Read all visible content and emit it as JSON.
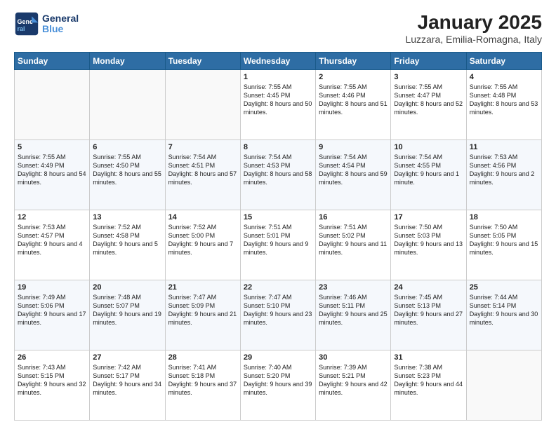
{
  "header": {
    "logo_line1": "General",
    "logo_line2": "Blue",
    "title": "January 2025",
    "subtitle": "Luzzara, Emilia-Romagna, Italy"
  },
  "weekdays": [
    "Sunday",
    "Monday",
    "Tuesday",
    "Wednesday",
    "Thursday",
    "Friday",
    "Saturday"
  ],
  "weeks": [
    [
      {
        "day": "",
        "info": ""
      },
      {
        "day": "",
        "info": ""
      },
      {
        "day": "",
        "info": ""
      },
      {
        "day": "1",
        "info": "Sunrise: 7:55 AM\nSunset: 4:45 PM\nDaylight: 8 hours\nand 50 minutes."
      },
      {
        "day": "2",
        "info": "Sunrise: 7:55 AM\nSunset: 4:46 PM\nDaylight: 8 hours\nand 51 minutes."
      },
      {
        "day": "3",
        "info": "Sunrise: 7:55 AM\nSunset: 4:47 PM\nDaylight: 8 hours\nand 52 minutes."
      },
      {
        "day": "4",
        "info": "Sunrise: 7:55 AM\nSunset: 4:48 PM\nDaylight: 8 hours\nand 53 minutes."
      }
    ],
    [
      {
        "day": "5",
        "info": "Sunrise: 7:55 AM\nSunset: 4:49 PM\nDaylight: 8 hours\nand 54 minutes."
      },
      {
        "day": "6",
        "info": "Sunrise: 7:55 AM\nSunset: 4:50 PM\nDaylight: 8 hours\nand 55 minutes."
      },
      {
        "day": "7",
        "info": "Sunrise: 7:54 AM\nSunset: 4:51 PM\nDaylight: 8 hours\nand 57 minutes."
      },
      {
        "day": "8",
        "info": "Sunrise: 7:54 AM\nSunset: 4:53 PM\nDaylight: 8 hours\nand 58 minutes."
      },
      {
        "day": "9",
        "info": "Sunrise: 7:54 AM\nSunset: 4:54 PM\nDaylight: 8 hours\nand 59 minutes."
      },
      {
        "day": "10",
        "info": "Sunrise: 7:54 AM\nSunset: 4:55 PM\nDaylight: 9 hours\nand 1 minute."
      },
      {
        "day": "11",
        "info": "Sunrise: 7:53 AM\nSunset: 4:56 PM\nDaylight: 9 hours\nand 2 minutes."
      }
    ],
    [
      {
        "day": "12",
        "info": "Sunrise: 7:53 AM\nSunset: 4:57 PM\nDaylight: 9 hours\nand 4 minutes."
      },
      {
        "day": "13",
        "info": "Sunrise: 7:52 AM\nSunset: 4:58 PM\nDaylight: 9 hours\nand 5 minutes."
      },
      {
        "day": "14",
        "info": "Sunrise: 7:52 AM\nSunset: 5:00 PM\nDaylight: 9 hours\nand 7 minutes."
      },
      {
        "day": "15",
        "info": "Sunrise: 7:51 AM\nSunset: 5:01 PM\nDaylight: 9 hours\nand 9 minutes."
      },
      {
        "day": "16",
        "info": "Sunrise: 7:51 AM\nSunset: 5:02 PM\nDaylight: 9 hours\nand 11 minutes."
      },
      {
        "day": "17",
        "info": "Sunrise: 7:50 AM\nSunset: 5:03 PM\nDaylight: 9 hours\nand 13 minutes."
      },
      {
        "day": "18",
        "info": "Sunrise: 7:50 AM\nSunset: 5:05 PM\nDaylight: 9 hours\nand 15 minutes."
      }
    ],
    [
      {
        "day": "19",
        "info": "Sunrise: 7:49 AM\nSunset: 5:06 PM\nDaylight: 9 hours\nand 17 minutes."
      },
      {
        "day": "20",
        "info": "Sunrise: 7:48 AM\nSunset: 5:07 PM\nDaylight: 9 hours\nand 19 minutes."
      },
      {
        "day": "21",
        "info": "Sunrise: 7:47 AM\nSunset: 5:09 PM\nDaylight: 9 hours\nand 21 minutes."
      },
      {
        "day": "22",
        "info": "Sunrise: 7:47 AM\nSunset: 5:10 PM\nDaylight: 9 hours\nand 23 minutes."
      },
      {
        "day": "23",
        "info": "Sunrise: 7:46 AM\nSunset: 5:11 PM\nDaylight: 9 hours\nand 25 minutes."
      },
      {
        "day": "24",
        "info": "Sunrise: 7:45 AM\nSunset: 5:13 PM\nDaylight: 9 hours\nand 27 minutes."
      },
      {
        "day": "25",
        "info": "Sunrise: 7:44 AM\nSunset: 5:14 PM\nDaylight: 9 hours\nand 30 minutes."
      }
    ],
    [
      {
        "day": "26",
        "info": "Sunrise: 7:43 AM\nSunset: 5:15 PM\nDaylight: 9 hours\nand 32 minutes."
      },
      {
        "day": "27",
        "info": "Sunrise: 7:42 AM\nSunset: 5:17 PM\nDaylight: 9 hours\nand 34 minutes."
      },
      {
        "day": "28",
        "info": "Sunrise: 7:41 AM\nSunset: 5:18 PM\nDaylight: 9 hours\nand 37 minutes."
      },
      {
        "day": "29",
        "info": "Sunrise: 7:40 AM\nSunset: 5:20 PM\nDaylight: 9 hours\nand 39 minutes."
      },
      {
        "day": "30",
        "info": "Sunrise: 7:39 AM\nSunset: 5:21 PM\nDaylight: 9 hours\nand 42 minutes."
      },
      {
        "day": "31",
        "info": "Sunrise: 7:38 AM\nSunset: 5:23 PM\nDaylight: 9 hours\nand 44 minutes."
      },
      {
        "day": "",
        "info": ""
      }
    ]
  ]
}
